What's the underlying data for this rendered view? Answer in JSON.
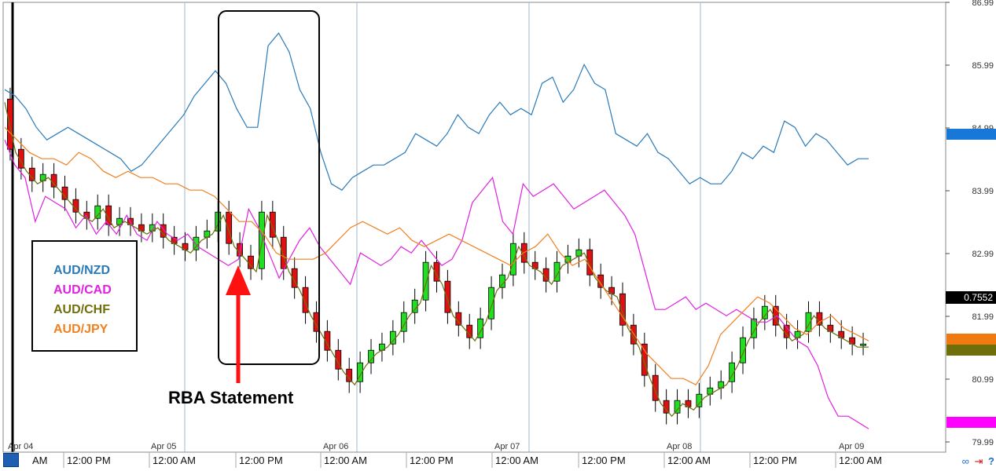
{
  "chart_data": {
    "type": "line",
    "title": "",
    "y_axis": {
      "tick_labels": [
        "86.99",
        "85.99",
        "84.99",
        "83.99",
        "82.99",
        "81.99",
        "80.99",
        "79.99"
      ],
      "current_price_label": "0.7552"
    },
    "x_axis": {
      "date_labels": [
        "Apr 04",
        "Apr 05",
        "Apr 06",
        "Apr 07",
        "Apr 08",
        "Apr 09"
      ],
      "time_labels": [
        "AM",
        "12:00 PM",
        "12:00 AM",
        "12:00 PM",
        "12:00 AM",
        "12:00 PM",
        "12:00 AM",
        "12:00 PM",
        "12:00 AM",
        "12:00 PM",
        "12:00 AM"
      ]
    },
    "legend": [
      {
        "name": "AUD/NZD",
        "color": "#2a7ab8"
      },
      {
        "name": "AUD/CAD",
        "color": "#e020e0"
      },
      {
        "name": "AUD/CHF",
        "color": "#6f6f0a"
      },
      {
        "name": "AUD/JPY",
        "color": "#f08020"
      }
    ],
    "annotation": "RBA Statement",
    "price_axis_markers": [
      {
        "series": "AUD/NZD",
        "color": "#1878d8"
      },
      {
        "series": "AUD/JPY",
        "color": "#f07a10"
      },
      {
        "series": "AUD/CHF",
        "color": "#6f6f0a"
      },
      {
        "series": "AUD/CAD",
        "color": "#ff00ff"
      }
    ],
    "candle_colors": {
      "up": "#22dd22",
      "down": "#dd1111"
    },
    "grid": "vertical-day-separators",
    "series": [
      {
        "name": "AUD/NZD",
        "values": [
          85.6,
          85.5,
          85.3,
          85.0,
          84.8,
          84.9,
          85.0,
          84.9,
          84.8,
          84.7,
          84.6,
          84.5,
          84.3,
          84.4,
          84.6,
          84.8,
          85.0,
          85.2,
          85.5,
          85.7,
          85.9,
          85.7,
          85.3,
          85.0,
          85.0,
          86.3,
          86.5,
          86.2,
          85.6,
          85.3,
          84.6,
          84.1,
          84.0,
          84.2,
          84.3,
          84.4,
          84.4,
          84.5,
          84.6,
          84.9,
          84.8,
          84.7,
          84.9,
          85.2,
          85.0,
          84.9,
          85.2,
          85.4,
          85.2,
          85.3,
          85.2,
          85.7,
          85.8,
          85.4,
          85.6,
          86.0,
          85.7,
          85.6,
          84.9,
          84.8,
          84.7,
          84.9,
          84.6,
          84.5,
          84.3,
          84.1,
          84.2,
          84.1,
          84.1,
          84.3,
          84.6,
          84.5,
          84.7,
          84.6,
          85.1,
          85.0,
          84.7,
          84.9,
          84.8,
          84.6,
          84.4,
          84.5,
          84.5
        ]
      },
      {
        "name": "AUD/CAD",
        "values": [
          84.8,
          84.4,
          84.2,
          83.5,
          83.9,
          83.8,
          83.7,
          83.4,
          83.6,
          83.3,
          83.5,
          83.3,
          83.6,
          83.3,
          83.2,
          83.5,
          83.3,
          83.2,
          83.3,
          83.1,
          83.0,
          82.9,
          82.8,
          82.9,
          83.7,
          83.4,
          83.0,
          82.6,
          82.9,
          83.2,
          83.4,
          83.1,
          82.9,
          82.7,
          82.5,
          83.0,
          82.9,
          82.8,
          82.9,
          83.1,
          83.0,
          83.2,
          83.0,
          82.8,
          82.9,
          83.2,
          83.8,
          84.0,
          84.2,
          83.5,
          83.3,
          84.1,
          83.9,
          84.0,
          84.1,
          83.9,
          83.7,
          83.8,
          83.9,
          84.0,
          83.8,
          83.6,
          83.3,
          82.7,
          82.1,
          82.1,
          82.2,
          82.3,
          82.1,
          82.2,
          82.1,
          82.0,
          82.1,
          82.0,
          81.9,
          81.9,
          82.0,
          81.8,
          81.6,
          81.5,
          81.2,
          80.7,
          80.4,
          80.4,
          80.3,
          80.2
        ]
      },
      {
        "name": "AUD/CHF",
        "values": [
          85.4,
          84.6,
          84.3,
          84.1,
          84.2,
          84.0,
          83.8,
          83.6,
          83.5,
          83.7,
          83.4,
          83.5,
          83.4,
          83.3,
          83.4,
          83.2,
          83.1,
          83.0,
          83.2,
          83.3,
          83.6,
          83.1,
          82.9,
          82.7,
          83.6,
          83.2,
          82.7,
          82.4,
          82.0,
          81.7,
          81.4,
          81.1,
          80.9,
          81.2,
          81.4,
          81.5,
          81.7,
          82.0,
          82.2,
          82.8,
          82.5,
          82.0,
          81.8,
          81.6,
          81.9,
          82.4,
          82.6,
          83.1,
          82.8,
          82.7,
          82.5,
          82.8,
          82.9,
          83.0,
          82.6,
          82.4,
          82.3,
          81.8,
          81.5,
          81.0,
          80.6,
          80.4,
          80.6,
          80.5,
          80.7,
          80.8,
          80.9,
          81.2,
          81.6,
          81.9,
          82.1,
          81.8,
          81.6,
          81.7,
          82.0,
          81.8,
          81.7,
          81.6,
          81.5,
          81.5
        ]
      },
      {
        "name": "AUD/JPY",
        "values": [
          85.0,
          84.8,
          84.6,
          84.5,
          84.5,
          84.4,
          84.6,
          84.5,
          84.3,
          84.2,
          84.3,
          84.2,
          84.2,
          84.1,
          84.1,
          84.0,
          84.0,
          83.9,
          83.7,
          83.5,
          83.5,
          83.3,
          83.0,
          82.9,
          82.9,
          82.9,
          83.0,
          83.2,
          83.4,
          83.5,
          83.4,
          83.3,
          83.4,
          83.2,
          83.1,
          83.2,
          83.3,
          83.2,
          83.1,
          83.0,
          82.9,
          82.8,
          83.0,
          83.1,
          83.3,
          83.0,
          82.8,
          82.9,
          82.6,
          82.3,
          82.0,
          81.7,
          81.4,
          81.2,
          81.0,
          81.0,
          80.9,
          81.2,
          81.7,
          81.9,
          82.1,
          82.3,
          82.2,
          82.0,
          81.8,
          81.7,
          81.9,
          82.0,
          81.8,
          81.7,
          81.6
        ]
      }
    ]
  }
}
